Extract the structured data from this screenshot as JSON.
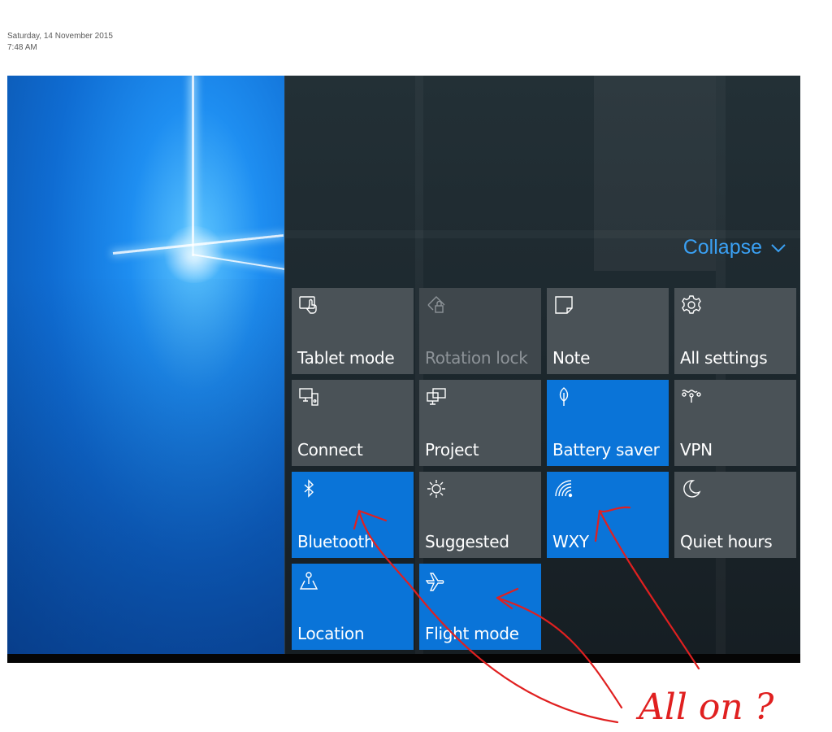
{
  "timestamp": {
    "date": "Saturday, 14 November 2015",
    "time": "7:48 AM"
  },
  "action_center": {
    "collapse_label": "Collapse",
    "collapse_icon": "chevron-down-icon",
    "accent_color": "#3aa0f3",
    "tile_on_color": "#0a74d8",
    "tile_off_color": "#4a5257",
    "tiles": [
      {
        "label": "Tablet mode",
        "icon": "tablet-mode-icon",
        "state": "off"
      },
      {
        "label": "Rotation lock",
        "icon": "rotation-lock-icon",
        "state": "disabled"
      },
      {
        "label": "Note",
        "icon": "note-icon",
        "state": "off"
      },
      {
        "label": "All settings",
        "icon": "gear-icon",
        "state": "off"
      },
      {
        "label": "Connect",
        "icon": "connect-icon",
        "state": "off"
      },
      {
        "label": "Project",
        "icon": "project-icon",
        "state": "off"
      },
      {
        "label": "Battery saver",
        "icon": "battery-saver-icon",
        "state": "on"
      },
      {
        "label": "VPN",
        "icon": "vpn-icon",
        "state": "off"
      },
      {
        "label": "Bluetooth",
        "icon": "bluetooth-icon",
        "state": "on"
      },
      {
        "label": "Suggested",
        "icon": "brightness-icon",
        "state": "off"
      },
      {
        "label": "WXY",
        "icon": "wifi-icon",
        "state": "on"
      },
      {
        "label": "Quiet hours",
        "icon": "moon-icon",
        "state": "off"
      },
      {
        "label": "Location",
        "icon": "location-icon",
        "state": "on"
      },
      {
        "label": "Flight mode",
        "icon": "airplane-icon",
        "state": "on"
      }
    ]
  },
  "annotation": {
    "text": "All on ?",
    "color": "#e02020"
  }
}
